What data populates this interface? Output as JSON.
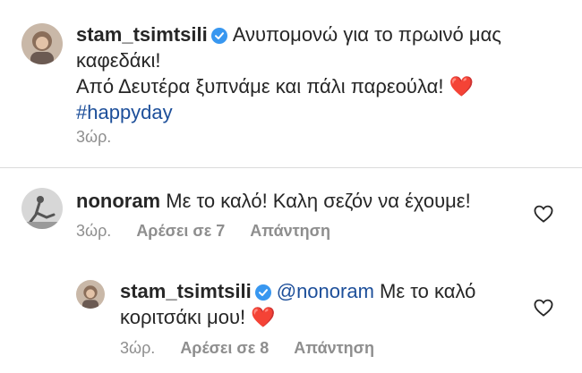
{
  "caption": {
    "username": "stam_tsimtsili",
    "line1": "Ανυπομονώ για το πρωινό μας",
    "line2": "καφεδάκι!",
    "line3": "Από Δευτέρα ξυπνάμε και πάλι παρεούλα! ❤️",
    "hashtag": "#happyday",
    "time": "3ώρ."
  },
  "comments": [
    {
      "username": "nonoram",
      "text": "Με το καλό! Καλη σεζόν να έχουμε!",
      "time": "3ώρ.",
      "likes": "Αρέσει σε 7",
      "reply_label": "Απάντηση"
    }
  ],
  "replies": [
    {
      "username": "stam_tsimtsili",
      "mention": "@nonoram",
      "text_line1": " Με το καλό",
      "text_line2": "κοριτσάκι μου! ❤️",
      "time": "3ώρ.",
      "likes": "Αρέσει σε 8",
      "reply_label": "Απάντηση"
    }
  ],
  "icons": {
    "verified": "verified-badge-icon",
    "like": "heart-outline-icon"
  },
  "colors": {
    "verified": "#3897f0",
    "link": "#1d4f9a",
    "meta": "#8e8e8e"
  }
}
